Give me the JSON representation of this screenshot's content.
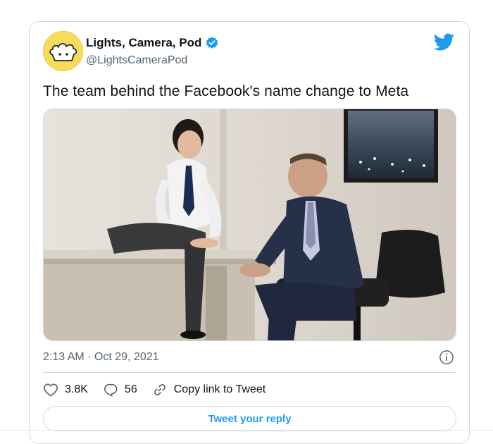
{
  "tweet": {
    "display_name": "Lights, Camera, Pod",
    "handle": "@LightsCameraPod",
    "text": "The team behind the Facebook's name change to Meta",
    "timestamp": "2:13 AM · Oct 29, 2021",
    "likes": "3.8K",
    "replies": "56",
    "copy_link_label": "Copy link to Tweet",
    "reply_button_label": "Tweet your reply"
  },
  "icons": {
    "verified": "verified-badge-icon",
    "brand": "twitter-bird-icon",
    "info": "info-icon",
    "like": "heart-icon",
    "reply": "speech-bubble-icon",
    "copy_link": "link-icon"
  },
  "colors": {
    "brand": "#1d9bf0",
    "avatar_bg": "#f7dc5c",
    "text": "#0f1419",
    "muted": "#536471",
    "border": "#cfd9de"
  }
}
